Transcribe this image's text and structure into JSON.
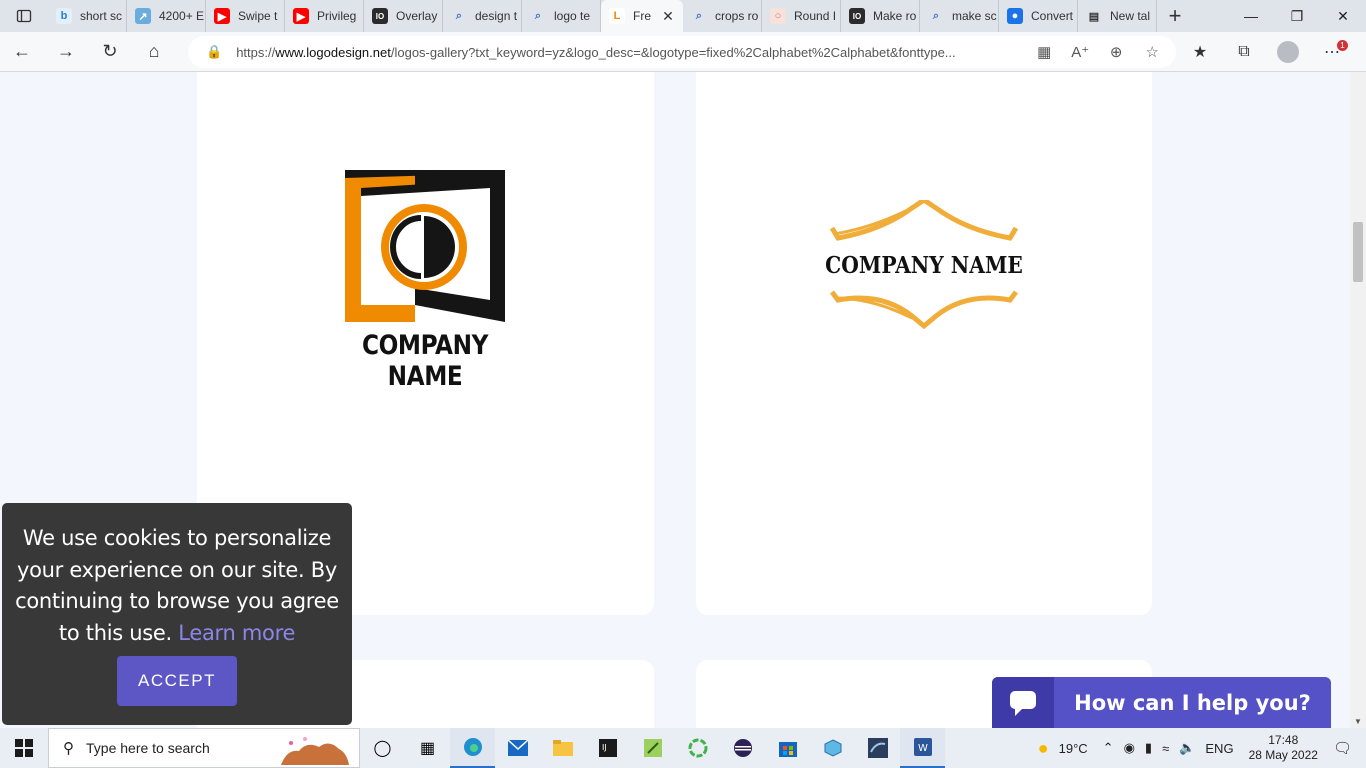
{
  "browser": {
    "tabs": [
      {
        "title": "short sc",
        "icon": "bing-icon"
      },
      {
        "title": "4200+ E",
        "icon": "image-icon"
      },
      {
        "title": "Swipe t",
        "icon": "youtube-icon"
      },
      {
        "title": "Privileg",
        "icon": "youtube-icon"
      },
      {
        "title": "Overlay",
        "icon": "io-icon"
      },
      {
        "title": "design t",
        "icon": "search-icon"
      },
      {
        "title": "logo te",
        "icon": "search-icon"
      },
      {
        "title": "Fre",
        "icon": "logodesign-icon",
        "active": true
      },
      {
        "title": "crops ro",
        "icon": "search-icon"
      },
      {
        "title": "Round I",
        "icon": "round-icon"
      },
      {
        "title": "Make ro",
        "icon": "io-icon"
      },
      {
        "title": "make sc",
        "icon": "search-icon"
      },
      {
        "title": "Convert",
        "icon": "convert-icon"
      },
      {
        "title": "New tal",
        "icon": "newtab-icon"
      }
    ],
    "url_prefix": "https://",
    "url_domain": "www.logodesign.net",
    "url_rest": "/logos-gallery?txt_keyword=yz&logo_desc=&logotype=fixed%2Calphabet%2Calphabet&fonttype..."
  },
  "logos": {
    "logo1_text": "COMPANY NAME",
    "logo2_text": "COMPANY NAME",
    "colors": {
      "orange": "#f08a00",
      "black": "#151515",
      "gold": "#f1ad3a"
    }
  },
  "cookie": {
    "message": "We use cookies to personalize your experience on our site. By continuing to browse you agree to this use.",
    "link": "Learn more",
    "accept": "ACCEPT"
  },
  "chat": {
    "text": "How can I help you?"
  },
  "taskbar": {
    "search_placeholder": "Type here to search",
    "weather": "19°C",
    "lang": "ENG",
    "time": "17:48",
    "date": "28 May 2022"
  }
}
